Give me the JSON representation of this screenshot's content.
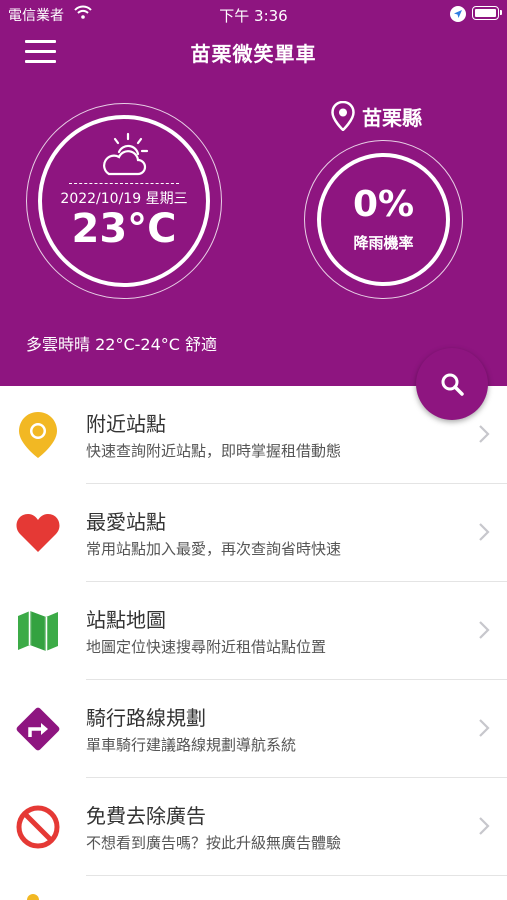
{
  "status_bar": {
    "carrier": "電信業者",
    "time": "下午 3:36"
  },
  "header": {
    "title": "苗栗微笑單車",
    "menu_icon": "hamburger-menu-icon",
    "background_color": "#8e1580"
  },
  "weather": {
    "icon": "partly-cloudy-icon",
    "date": "2022/10/19 星期三",
    "temperature": "23°C",
    "description": "多雲時晴 22°C-24°C 舒適"
  },
  "location": {
    "icon": "location-pin-icon",
    "county": "苗栗縣"
  },
  "rain": {
    "value": "0%",
    "label": "降雨機率"
  },
  "search_button": {
    "icon": "search-icon"
  },
  "menu_items": [
    {
      "title": "附近站點",
      "subtitle": "快速查詢附近站點，即時掌握租借動態",
      "icon": "map-pin-icon",
      "icon_color": "#f2b823"
    },
    {
      "title": "最愛站點",
      "subtitle": "常用站點加入最愛，再次查詢省時快速",
      "icon": "heart-icon",
      "icon_color": "#e53935"
    },
    {
      "title": "站點地圖",
      "subtitle": "地圖定位快速搜尋附近租借站點位置",
      "icon": "folded-map-icon",
      "icon_color": "#3cab47"
    },
    {
      "title": "騎行路線規劃",
      "subtitle": "單車騎行建議路線規劃導航系統",
      "icon": "route-turn-icon",
      "icon_color": "#8e1580"
    },
    {
      "title": "免費去除廣告",
      "subtitle": "不想看到廣告嗎？按此升級無廣告體驗",
      "icon": "no-ads-icon",
      "icon_color": "#e53935"
    }
  ]
}
